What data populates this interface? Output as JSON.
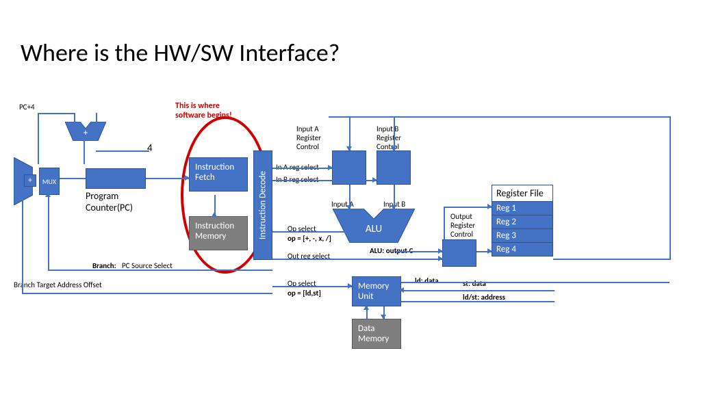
{
  "title": "Where is the HW/SW Interface?",
  "annotation": "This is where software begins!",
  "labels": {
    "pc4": "PC+4",
    "four": "4",
    "mux": "MUX",
    "plus": "+",
    "pc": "Program Counter(PC)",
    "ifetch": "Instruction Fetch",
    "imem": "Instruction Memory",
    "idecode": "Instruction Decode",
    "branch": "Branch:",
    "branch2": "PC Source Select",
    "bto": "Branch Target Address Offset",
    "inaregctrl": "Input A Register Control",
    "inbregctrl": "Input B Register Control",
    "inasel": "In A reg select",
    "inbsel": "In B reg select",
    "inputa": "Input A",
    "inputb": "Input B",
    "opsel1": "Op select",
    "opset1": "op = [+, -, x, /]",
    "alu": "ALU",
    "aluout": "ALU: output C",
    "outregsel": "Out reg select",
    "outregctrl": "Output Register Control",
    "rf": "Register File",
    "r1": "Reg 1",
    "r2": "Reg 2",
    "r3": "Reg 3",
    "r4": "Reg 4",
    "opsel2": "Op select",
    "opset2": "op = [ld,st]",
    "memunit": "Memory Unit",
    "dmem": "Data Memory",
    "lddata": "ld: data",
    "stdata": "st: data",
    "ldstaddr": "ld/st: address"
  }
}
